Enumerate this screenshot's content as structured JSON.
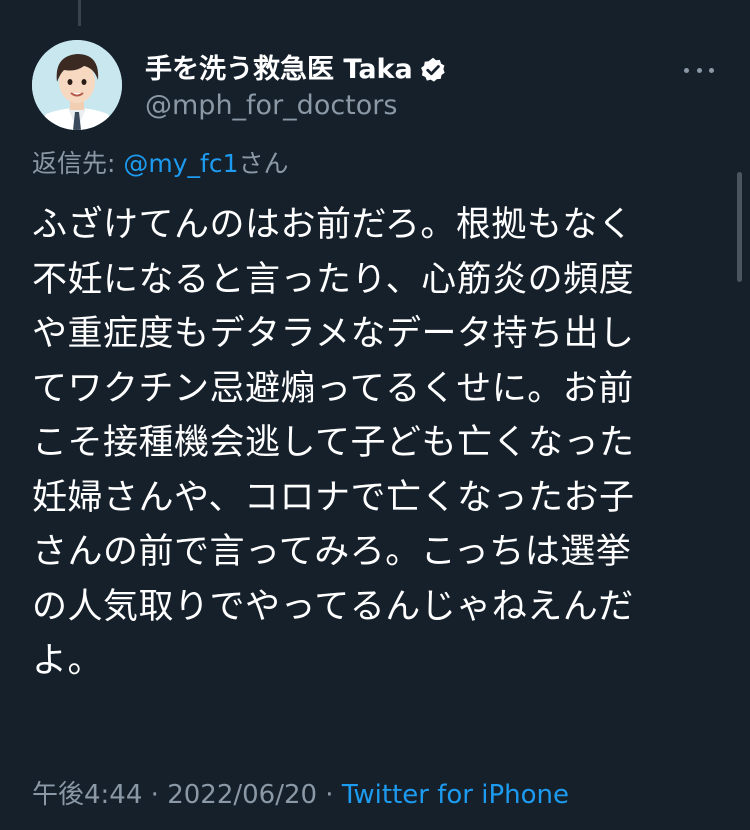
{
  "author": {
    "display_name": "手を洗う救急医 Taka",
    "handle": "@mph_for_doctors",
    "verified": true,
    "avatar_icon": "avatar-doctor-illustration"
  },
  "more_icon": "more-dots-icon",
  "reply": {
    "prefix": "返信先:",
    "mention": "@my_fc1",
    "suffix": "さん"
  },
  "tweet_lines": [
    "ふざけてんのはお前だろ。根拠もなく",
    "不妊になると言ったり、心筋炎の頻度",
    "や重症度もデタラメなデータ持ち出し",
    "てワクチン忌避煽ってるくせに。お前",
    "こそ接種機会逃して子ども亡くなった",
    "妊婦さんや、コロナで亡くなったお子",
    "さんの前で言ってみろ。こっちは選挙",
    "の人気取りでやってるんじゃねえんだ",
    "よ。"
  ],
  "meta": {
    "time": "午後4:44",
    "sep1": " · ",
    "date": "2022/06/20",
    "sep2": " · ",
    "source": "Twitter for iPhone"
  },
  "colors": {
    "background": "#15202b",
    "text": "#ffffff",
    "secondary": "#8b98a5",
    "link": "#1d9bf0"
  }
}
